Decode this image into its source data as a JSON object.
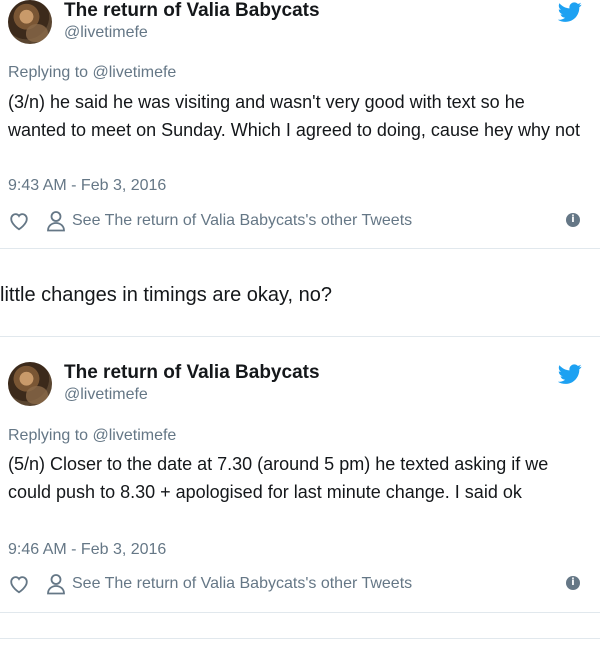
{
  "tweets": [
    {
      "name": "The return of Valia Babycats",
      "handle": "@livetimefe",
      "replying_to": "Replying to @livetimefe",
      "text": "(3/n) he said he was visiting and wasn't very good with text so he wanted to meet on Sunday.  Which I agreed to doing, cause hey why not",
      "time": "9:43 AM - Feb 3, 2016",
      "other_tweets": "See The return of Valia Babycats's other Tweets"
    },
    {
      "name": "The return of Valia Babycats",
      "handle": "@livetimefe",
      "replying_to": "Replying to @livetimefe",
      "text": "(5/n) Closer to the date at 7.30 (around 5 pm)  he texted asking if we could push to 8.30 + apologised for last minute change. I said ok",
      "time": "9:46 AM - Feb 3, 2016",
      "other_tweets": "See The return of Valia Babycats's other Tweets"
    }
  ],
  "caption": "little changes in timings are okay, no?",
  "icons": {
    "brand": "twitter-bird-icon",
    "like": "heart-icon",
    "profile": "person-icon",
    "info": "info-icon"
  },
  "colors": {
    "twitter_blue": "#1da1f2",
    "text": "#14171a",
    "secondary": "#657786",
    "divider": "#e1e8ed"
  }
}
